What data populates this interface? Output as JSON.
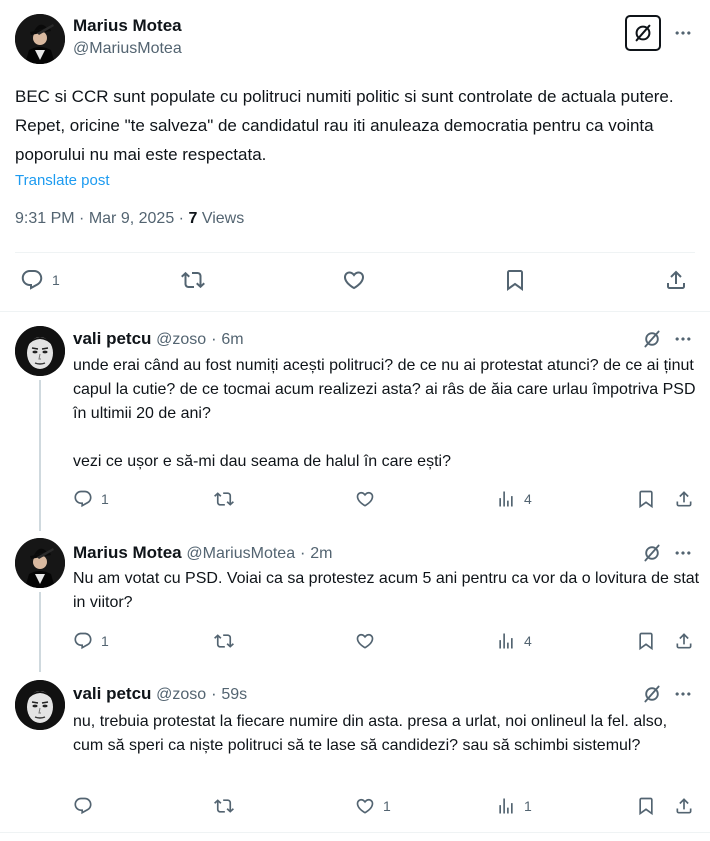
{
  "main_post": {
    "author_name": "Marius Motea",
    "author_handle": "@MariusMotea",
    "text": "BEC si CCR sunt populate cu politruci numiti politic si sunt controlate de actuala putere. Repet, oricine \"te salveza\" de candidatul rau iti anuleaza democratia pentru ca vointa poporului nu mai este respectata.",
    "translate_label": "Translate post",
    "time": "9:31 PM",
    "date": "Mar 9, 2025",
    "views_count": "7",
    "views_label": "Views",
    "reply_count": "1"
  },
  "replies": [
    {
      "author_name": "vali petcu",
      "author_handle": "@zoso",
      "time": "6m",
      "text": "unde erai când au fost numiți acești politruci? de ce nu ai protestat atunci? de ce ai ținut capul la cutie? de ce tocmai acum realizezi asta? ai râs de ăia care urlau împotriva PSD în ultimii 20 de ani?\n\nvezi ce ușor e să-mi dau seama de halul în care ești?",
      "reply_count": "1",
      "like_count": "",
      "views_count": "4"
    },
    {
      "author_name": "Marius Motea",
      "author_handle": "@MariusMotea",
      "time": "2m",
      "text": "Nu am votat cu PSD. Voiai ca sa protestez acum 5 ani pentru ca vor da o lovitura de stat in viitor?",
      "reply_count": "1",
      "like_count": "",
      "views_count": "4"
    },
    {
      "author_name": "vali petcu",
      "author_handle": "@zoso",
      "time": "59s",
      "text": "nu, trebuia protestat la fiecare numire din asta. presa a urlat, noi onlineul la fel. also, cum să speri ca niște politruci să te lase să candidezi? sau să schimbi sistemul?",
      "reply_count": "",
      "like_count": "1",
      "views_count": "1"
    }
  ],
  "separator": "·",
  "icons": {
    "grok": "grok-icon",
    "more": "more-icon",
    "reply": "reply-icon",
    "repost": "repost-icon",
    "like": "like-icon",
    "bookmark": "bookmark-icon",
    "share": "share-icon",
    "views": "views-icon"
  },
  "colors": {
    "text": "#0f1419",
    "muted": "#536471",
    "link": "#1d9bf0",
    "divider": "#eff3f4"
  }
}
